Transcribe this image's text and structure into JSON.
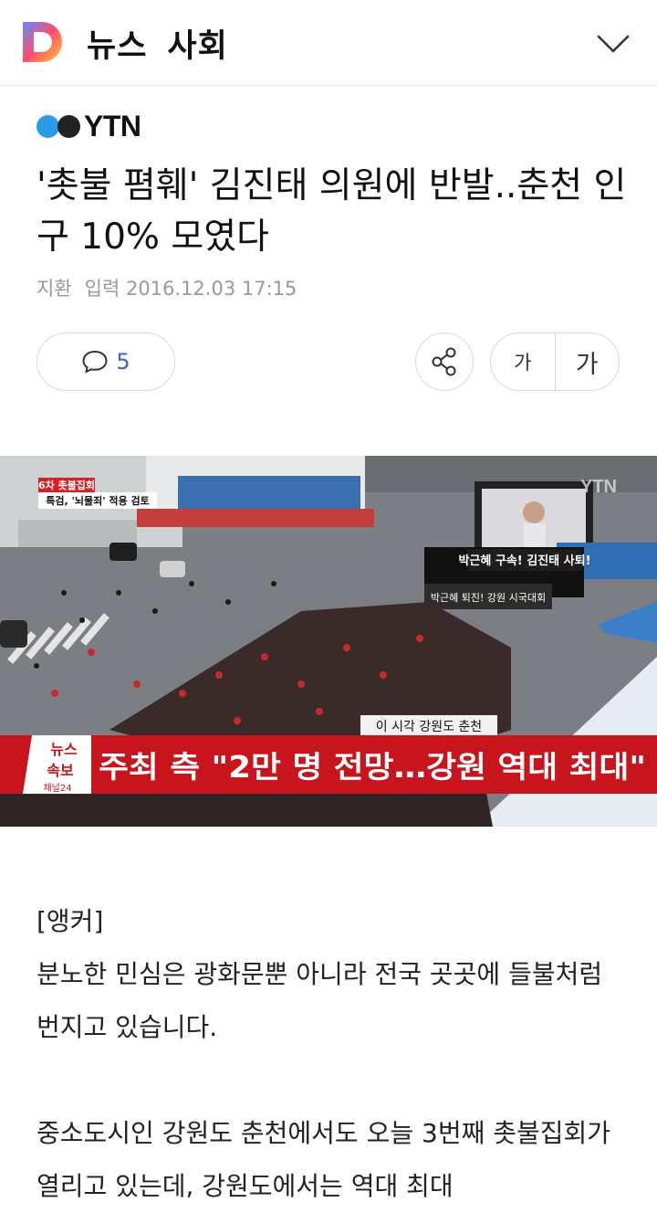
{
  "header": {
    "logo_letter": "D",
    "section": "뉴스",
    "subsection": "사회",
    "expand_icon": "chevron-down-icon"
  },
  "article": {
    "press": "YTN",
    "headline": "'촛불 폄훼' 김진태 의원에 반발..춘천 인구 10% 모였다",
    "meta": {
      "author": "지환",
      "date": "입력 2016.12.03 17:15"
    },
    "comment_count": "5",
    "font_small_label": "가",
    "font_large_label": "가",
    "image": {
      "badge_line1": "6차 촛불집회",
      "badge_line2": "특검, '뇌물죄' 적용 검토",
      "watermark": "YTN",
      "location_caption": "이 시각 강원도 춘천",
      "breaking_label_1": "뉴스",
      "breaking_label_2": "속보",
      "channel": "채널24",
      "headline_ticker": "주최 측 \"2만 명 전망…강원 역대 최대\"",
      "stage_banner": "박근혜 구속! 김진태 사퇴!",
      "stage_banner_2": "박근혜 퇴진! 강원 시국대회"
    },
    "paragraphs": [
      "[앵커]",
      "분노한 민심은 광화문뿐 아니라 전국 곳곳에 들불처럼 번지고 있습니다.",
      "중소도시인 강원도 춘천에서도 오늘 3번째 촛불집회가 열리고 있는데, 강원도에서는 역대 최대"
    ]
  },
  "colors": {
    "accent_blue": "#3a63c9",
    "ytn_blue": "#2b9be8",
    "breaking_red": "#c8141d"
  }
}
